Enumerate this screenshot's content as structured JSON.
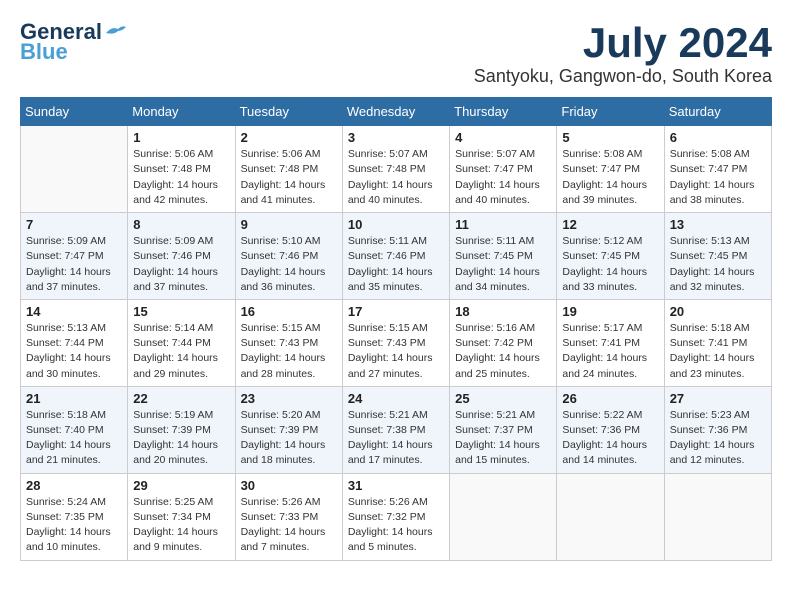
{
  "logo": {
    "line1": "General",
    "line2": "Blue"
  },
  "title": {
    "month": "July 2024",
    "location": "Santyoku, Gangwon-do, South Korea"
  },
  "headers": [
    "Sunday",
    "Monday",
    "Tuesday",
    "Wednesday",
    "Thursday",
    "Friday",
    "Saturday"
  ],
  "weeks": [
    [
      {
        "day": "",
        "info": ""
      },
      {
        "day": "1",
        "info": "Sunrise: 5:06 AM\nSunset: 7:48 PM\nDaylight: 14 hours\nand 42 minutes."
      },
      {
        "day": "2",
        "info": "Sunrise: 5:06 AM\nSunset: 7:48 PM\nDaylight: 14 hours\nand 41 minutes."
      },
      {
        "day": "3",
        "info": "Sunrise: 5:07 AM\nSunset: 7:48 PM\nDaylight: 14 hours\nand 40 minutes."
      },
      {
        "day": "4",
        "info": "Sunrise: 5:07 AM\nSunset: 7:47 PM\nDaylight: 14 hours\nand 40 minutes."
      },
      {
        "day": "5",
        "info": "Sunrise: 5:08 AM\nSunset: 7:47 PM\nDaylight: 14 hours\nand 39 minutes."
      },
      {
        "day": "6",
        "info": "Sunrise: 5:08 AM\nSunset: 7:47 PM\nDaylight: 14 hours\nand 38 minutes."
      }
    ],
    [
      {
        "day": "7",
        "info": "Sunrise: 5:09 AM\nSunset: 7:47 PM\nDaylight: 14 hours\nand 37 minutes."
      },
      {
        "day": "8",
        "info": "Sunrise: 5:09 AM\nSunset: 7:46 PM\nDaylight: 14 hours\nand 37 minutes."
      },
      {
        "day": "9",
        "info": "Sunrise: 5:10 AM\nSunset: 7:46 PM\nDaylight: 14 hours\nand 36 minutes."
      },
      {
        "day": "10",
        "info": "Sunrise: 5:11 AM\nSunset: 7:46 PM\nDaylight: 14 hours\nand 35 minutes."
      },
      {
        "day": "11",
        "info": "Sunrise: 5:11 AM\nSunset: 7:45 PM\nDaylight: 14 hours\nand 34 minutes."
      },
      {
        "day": "12",
        "info": "Sunrise: 5:12 AM\nSunset: 7:45 PM\nDaylight: 14 hours\nand 33 minutes."
      },
      {
        "day": "13",
        "info": "Sunrise: 5:13 AM\nSunset: 7:45 PM\nDaylight: 14 hours\nand 32 minutes."
      }
    ],
    [
      {
        "day": "14",
        "info": "Sunrise: 5:13 AM\nSunset: 7:44 PM\nDaylight: 14 hours\nand 30 minutes."
      },
      {
        "day": "15",
        "info": "Sunrise: 5:14 AM\nSunset: 7:44 PM\nDaylight: 14 hours\nand 29 minutes."
      },
      {
        "day": "16",
        "info": "Sunrise: 5:15 AM\nSunset: 7:43 PM\nDaylight: 14 hours\nand 28 minutes."
      },
      {
        "day": "17",
        "info": "Sunrise: 5:15 AM\nSunset: 7:43 PM\nDaylight: 14 hours\nand 27 minutes."
      },
      {
        "day": "18",
        "info": "Sunrise: 5:16 AM\nSunset: 7:42 PM\nDaylight: 14 hours\nand 25 minutes."
      },
      {
        "day": "19",
        "info": "Sunrise: 5:17 AM\nSunset: 7:41 PM\nDaylight: 14 hours\nand 24 minutes."
      },
      {
        "day": "20",
        "info": "Sunrise: 5:18 AM\nSunset: 7:41 PM\nDaylight: 14 hours\nand 23 minutes."
      }
    ],
    [
      {
        "day": "21",
        "info": "Sunrise: 5:18 AM\nSunset: 7:40 PM\nDaylight: 14 hours\nand 21 minutes."
      },
      {
        "day": "22",
        "info": "Sunrise: 5:19 AM\nSunset: 7:39 PM\nDaylight: 14 hours\nand 20 minutes."
      },
      {
        "day": "23",
        "info": "Sunrise: 5:20 AM\nSunset: 7:39 PM\nDaylight: 14 hours\nand 18 minutes."
      },
      {
        "day": "24",
        "info": "Sunrise: 5:21 AM\nSunset: 7:38 PM\nDaylight: 14 hours\nand 17 minutes."
      },
      {
        "day": "25",
        "info": "Sunrise: 5:21 AM\nSunset: 7:37 PM\nDaylight: 14 hours\nand 15 minutes."
      },
      {
        "day": "26",
        "info": "Sunrise: 5:22 AM\nSunset: 7:36 PM\nDaylight: 14 hours\nand 14 minutes."
      },
      {
        "day": "27",
        "info": "Sunrise: 5:23 AM\nSunset: 7:36 PM\nDaylight: 14 hours\nand 12 minutes."
      }
    ],
    [
      {
        "day": "28",
        "info": "Sunrise: 5:24 AM\nSunset: 7:35 PM\nDaylight: 14 hours\nand 10 minutes."
      },
      {
        "day": "29",
        "info": "Sunrise: 5:25 AM\nSunset: 7:34 PM\nDaylight: 14 hours\nand 9 minutes."
      },
      {
        "day": "30",
        "info": "Sunrise: 5:26 AM\nSunset: 7:33 PM\nDaylight: 14 hours\nand 7 minutes."
      },
      {
        "day": "31",
        "info": "Sunrise: 5:26 AM\nSunset: 7:32 PM\nDaylight: 14 hours\nand 5 minutes."
      },
      {
        "day": "",
        "info": ""
      },
      {
        "day": "",
        "info": ""
      },
      {
        "day": "",
        "info": ""
      }
    ]
  ]
}
